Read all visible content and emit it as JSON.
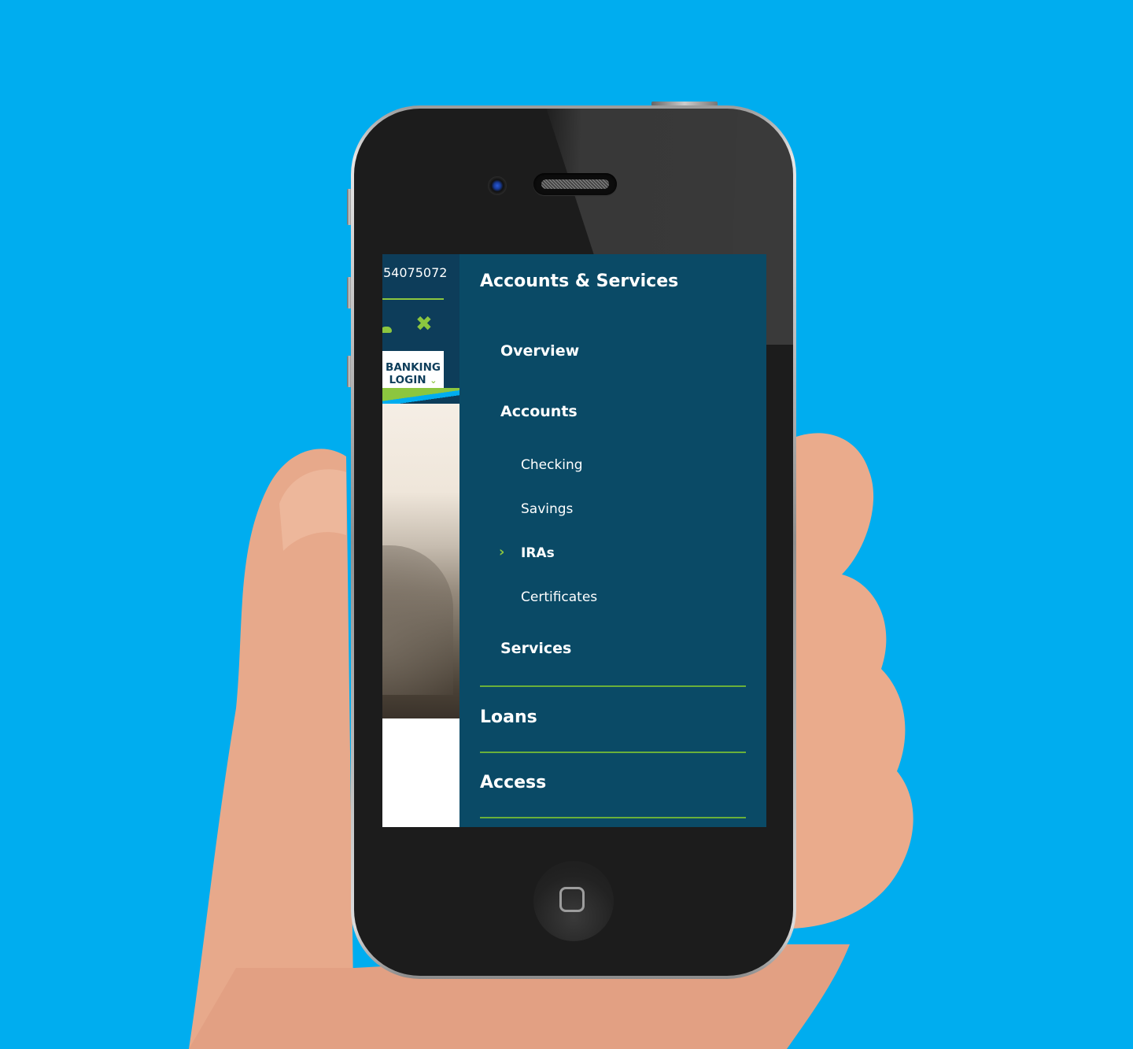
{
  "site": {
    "phone_number": "54075072",
    "login_button": "BANKING LOGIN",
    "close_icon": "close-x-icon",
    "accent_color": "#8cc63f",
    "menu_bg_color": "#0a4a66"
  },
  "menu": {
    "title": "Accounts & Services",
    "sections": [
      {
        "label": "Overview"
      },
      {
        "label": "Accounts",
        "children": [
          {
            "label": "Checking"
          },
          {
            "label": "Savings"
          },
          {
            "label": "IRAs",
            "active": true
          },
          {
            "label": "Certificates"
          }
        ]
      },
      {
        "label": "Services"
      }
    ],
    "top_level": [
      {
        "label": "Loans"
      },
      {
        "label": "Access"
      }
    ]
  }
}
